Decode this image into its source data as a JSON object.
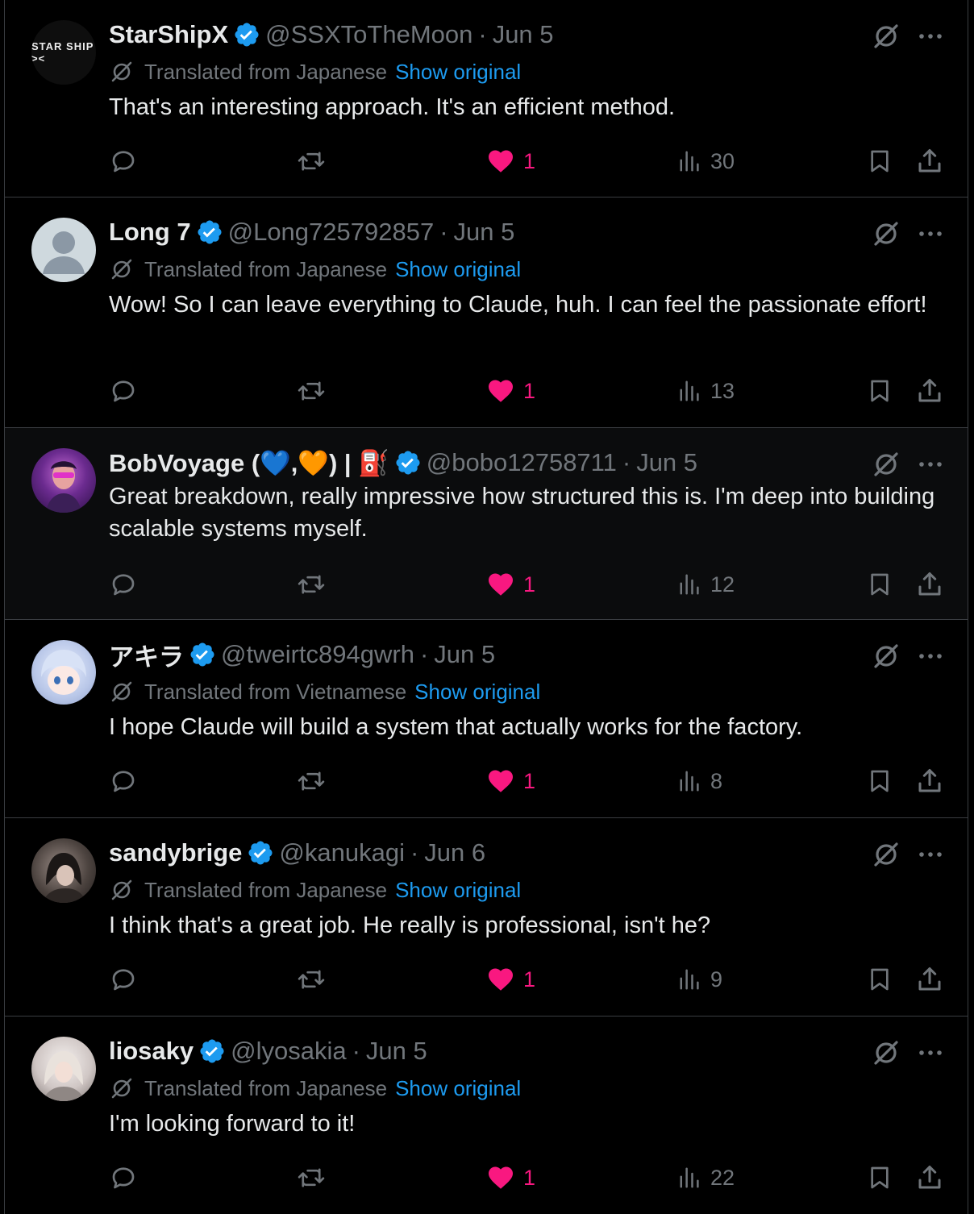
{
  "tweets": [
    {
      "name": "StarShipX",
      "handle": "@SSXToTheMoon",
      "date": "Jun 5",
      "avatar": "starship-logo",
      "avatar_text": "STAR SHIP ><",
      "translated_from": "Translated from Japanese",
      "show_original": "Show original",
      "text": "That's an interesting approach. It's an efficient method.",
      "likes": "1",
      "views": "30"
    },
    {
      "name": "Long 7",
      "handle": "@Long725792857",
      "date": "Jun 5",
      "avatar": "default-avatar",
      "translated_from": "Translated from Japanese",
      "show_original": "Show original",
      "text": "Wow! So I can leave everything to Claude, huh. I can feel the passionate effort!",
      "likes": "1",
      "views": "13"
    },
    {
      "name": "BobVoyage (💙,🧡) | ⛽",
      "handle": "@bobo12758711",
      "date": "Jun 5",
      "avatar": "bob-avatar",
      "text": "Great breakdown, really impressive how structured this is. I'm deep into building scalable systems myself.",
      "likes": "1",
      "views": "12"
    },
    {
      "name": "アキラ",
      "handle": "@tweirtc894gwrh",
      "date": "Jun 5",
      "avatar": "akira-avatar",
      "translated_from": "Translated from Vietnamese",
      "show_original": "Show original",
      "text": "I hope Claude will build a system that actually works for the factory.",
      "likes": "1",
      "views": "8"
    },
    {
      "name": "sandybrige",
      "handle": "@kanukagi",
      "date": "Jun 6",
      "avatar": "sandy-avatar",
      "translated_from": "Translated from Japanese",
      "show_original": "Show original",
      "text": "I think that's a great job. He really is professional, isn't he?",
      "likes": "1",
      "views": "9"
    },
    {
      "name": "liosaky",
      "handle": "@lyosakia",
      "date": "Jun 5",
      "avatar": "liosaky-avatar",
      "translated_from": "Translated from Japanese",
      "show_original": "Show original",
      "text": "I'm looking forward to it!",
      "likes": "1",
      "views": "22"
    }
  ],
  "separator": "·",
  "colors": {
    "background": "#000000",
    "text": "#e7e9ea",
    "muted": "#71767b",
    "link": "#1d9bf0",
    "like": "#f91880",
    "verified": "#1d9bf0",
    "border": "#3a3d41"
  }
}
